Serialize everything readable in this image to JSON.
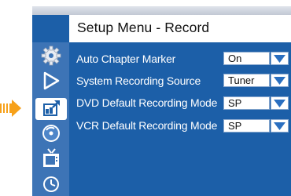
{
  "menu": {
    "title": "Setup Menu - Record"
  },
  "sidebar": {
    "items": [
      {
        "icon": "gear-icon"
      },
      {
        "icon": "play-icon"
      },
      {
        "icon": "record-settings-icon",
        "selected": true
      },
      {
        "icon": "disc-icon"
      },
      {
        "icon": "tv-icon"
      },
      {
        "icon": "clock-icon"
      }
    ]
  },
  "settings": [
    {
      "label": "Auto Chapter Marker",
      "value": "On"
    },
    {
      "label": "System Recording Source",
      "value": "Tuner"
    },
    {
      "label": "DVD Default Recording Mode",
      "value": "SP"
    },
    {
      "label": "VCR Default Recording Mode",
      "value": "SP"
    }
  ],
  "colors": {
    "panel": "#1c5fa8",
    "sidebar": "#3d74b6",
    "pointer": "#f7a11a",
    "text": "#ffffff"
  }
}
